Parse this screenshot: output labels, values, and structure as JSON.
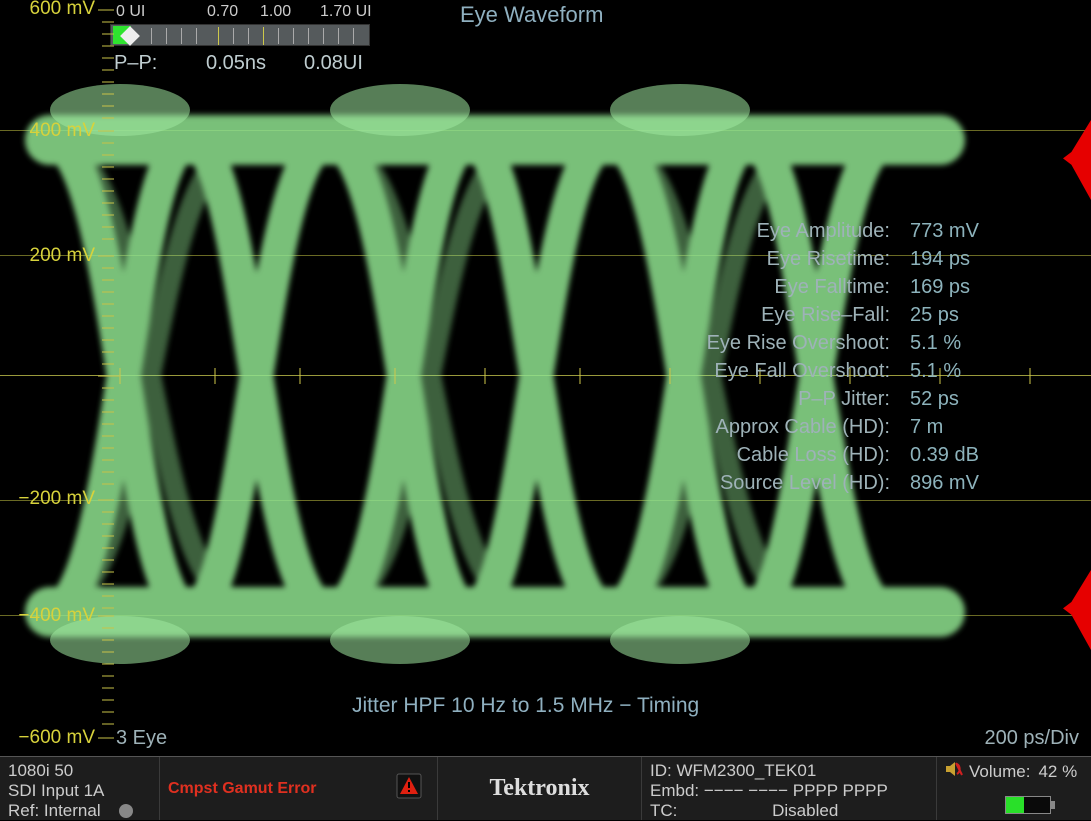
{
  "title": "Eye Waveform",
  "yaxis": {
    "p600": "600 mV",
    "p400": "400 mV",
    "p200": "200 mV",
    "m200": "−200 mV",
    "m400": "−400 mV",
    "m600": "−600 mV"
  },
  "slider": {
    "l0": "0 UI",
    "l07": "0.70",
    "l10": "1.00",
    "l17": "1.70 UI"
  },
  "pp": {
    "label": "P–P:",
    "ns": "0.05ns",
    "ui": "0.08UI"
  },
  "measurements": [
    {
      "label": "Eye Amplitude:",
      "value": "773 mV"
    },
    {
      "label": "Eye Risetime:",
      "value": "194 ps"
    },
    {
      "label": "Eye Falltime:",
      "value": "169 ps"
    },
    {
      "label": "Eye Rise–Fall:",
      "value": "25 ps"
    },
    {
      "label": "Eye Rise Overshoot:",
      "value": "5.1 %"
    },
    {
      "label": "Eye Fall Overshoot:",
      "value": "5.1 %"
    },
    {
      "label": "P–P Jitter:",
      "value": "52 ps"
    },
    {
      "label": "Approx Cable (HD):",
      "value": "7 m"
    },
    {
      "label": "Cable Loss (HD):",
      "value": "0.39 dB"
    },
    {
      "label": "Source Level (HD):",
      "value": "896 mV"
    }
  ],
  "footer": {
    "jitter": "Jitter HPF 10 Hz to 1.5 MHz − Timing",
    "eye": "3 Eye",
    "scale": "200 ps/Div"
  },
  "status": {
    "fmt": "1080i 50",
    "input": "SDI Input 1A",
    "ref": "Ref: Internal",
    "gamut": "Cmpst Gamut Error",
    "brand": "Tektronix",
    "id": "ID: WFM2300_TEK01",
    "embd": "Embd:  −−−− −−−− PPPP PPPP",
    "tc": "TC:",
    "tc_val": "Disabled",
    "vol_label": "Volume:",
    "vol_val": "42 %"
  }
}
